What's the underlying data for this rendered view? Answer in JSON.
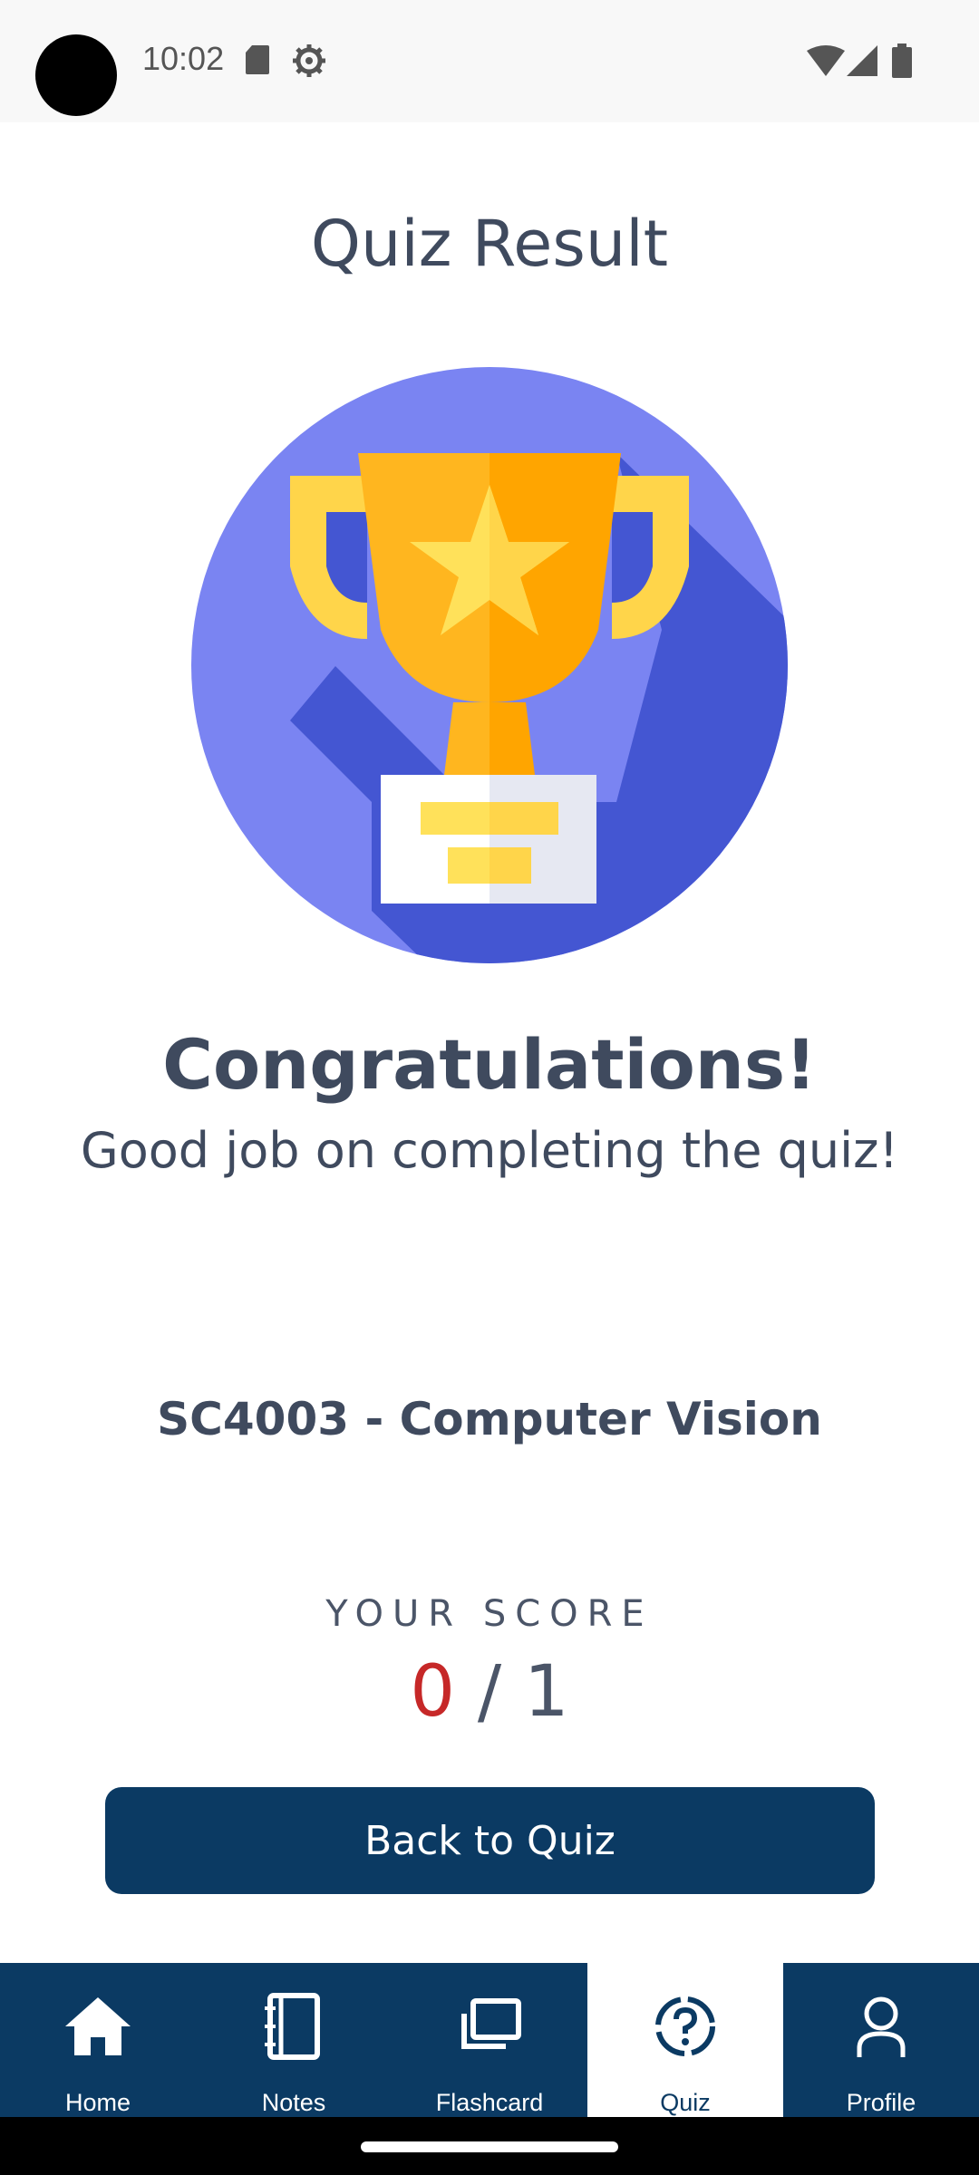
{
  "status_bar": {
    "time": "10:02",
    "icons": [
      "sd-card-icon",
      "settings-gear-icon",
      "wifi-icon",
      "cell-signal-icon",
      "battery-icon"
    ]
  },
  "page": {
    "title": "Quiz Result",
    "congrats": "Congratulations!",
    "subtext": "Good job on completing the quiz!",
    "course": "SC4003 - Computer Vision",
    "score_label": "YOUR SCORE",
    "score_value": "0",
    "score_sep": " / ",
    "score_total": "1",
    "back_button": "Back to Quiz"
  },
  "nav": {
    "items": [
      {
        "label": "Home",
        "icon": "home-icon"
      },
      {
        "label": "Notes",
        "icon": "notes-icon"
      },
      {
        "label": "Flashcard",
        "icon": "flashcard-icon"
      },
      {
        "label": "Quiz",
        "icon": "quiz-icon",
        "active": true
      },
      {
        "label": "Profile",
        "icon": "profile-icon"
      }
    ]
  },
  "colors": {
    "primary": "#0b3a63",
    "text": "#3f4a5e",
    "score_red": "#c62828",
    "trophy_bg": "#7a84f2"
  }
}
